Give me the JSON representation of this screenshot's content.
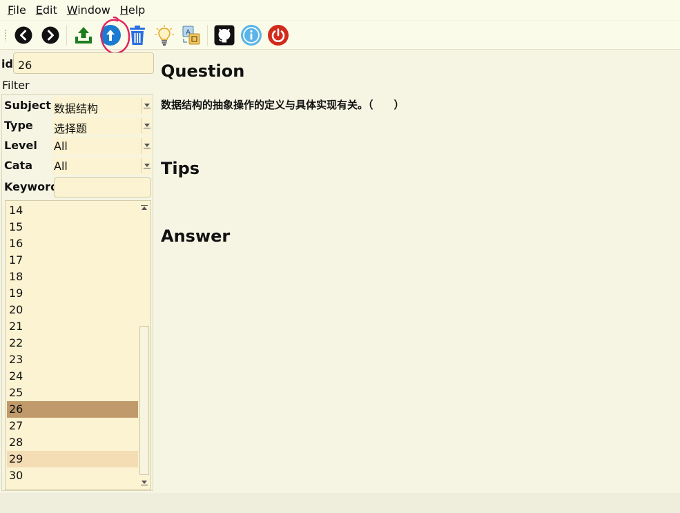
{
  "menu": [
    {
      "key": "F",
      "rest": "ile"
    },
    {
      "key": "E",
      "rest": "dit"
    },
    {
      "key": "W",
      "rest": "indow"
    },
    {
      "key": "H",
      "rest": "elp"
    }
  ],
  "toolbar": {
    "icons": [
      "back-icon",
      "forward-icon",
      "upload-icon",
      "submit-up-icon",
      "trash-icon",
      "lightbulb-icon",
      "translate-icon",
      "github-icon",
      "info-icon",
      "power-icon"
    ],
    "colors": {
      "dark": "#111111",
      "green": "#1e7d1e",
      "blue": "#1a7bd1",
      "trash": "#2c6fe0",
      "red": "#d12b1c",
      "info": "#5ab4e8",
      "annotation": "#e0235e"
    }
  },
  "left": {
    "id_label": "id",
    "id_value": "26",
    "filter_title": "Filter",
    "filters": [
      {
        "label": "Subject",
        "value": "数据结构"
      },
      {
        "label": "Type",
        "value": "选择题"
      },
      {
        "label": "Level",
        "value": "All"
      },
      {
        "label": "Cata",
        "value": "All"
      }
    ],
    "keyword_label": "Keyword",
    "keyword_value": "",
    "list_items": [
      "14",
      "15",
      "16",
      "17",
      "18",
      "19",
      "20",
      "21",
      "22",
      "23",
      "24",
      "25",
      "26",
      "27",
      "28",
      "29",
      "30"
    ],
    "selected_item": "26",
    "hovered_item": "29"
  },
  "content": {
    "question_heading": "Question",
    "question_text": "数据结构的抽象操作的定义与具体实现有关。（　　）",
    "tips_heading": "Tips",
    "answer_heading": "Answer"
  }
}
